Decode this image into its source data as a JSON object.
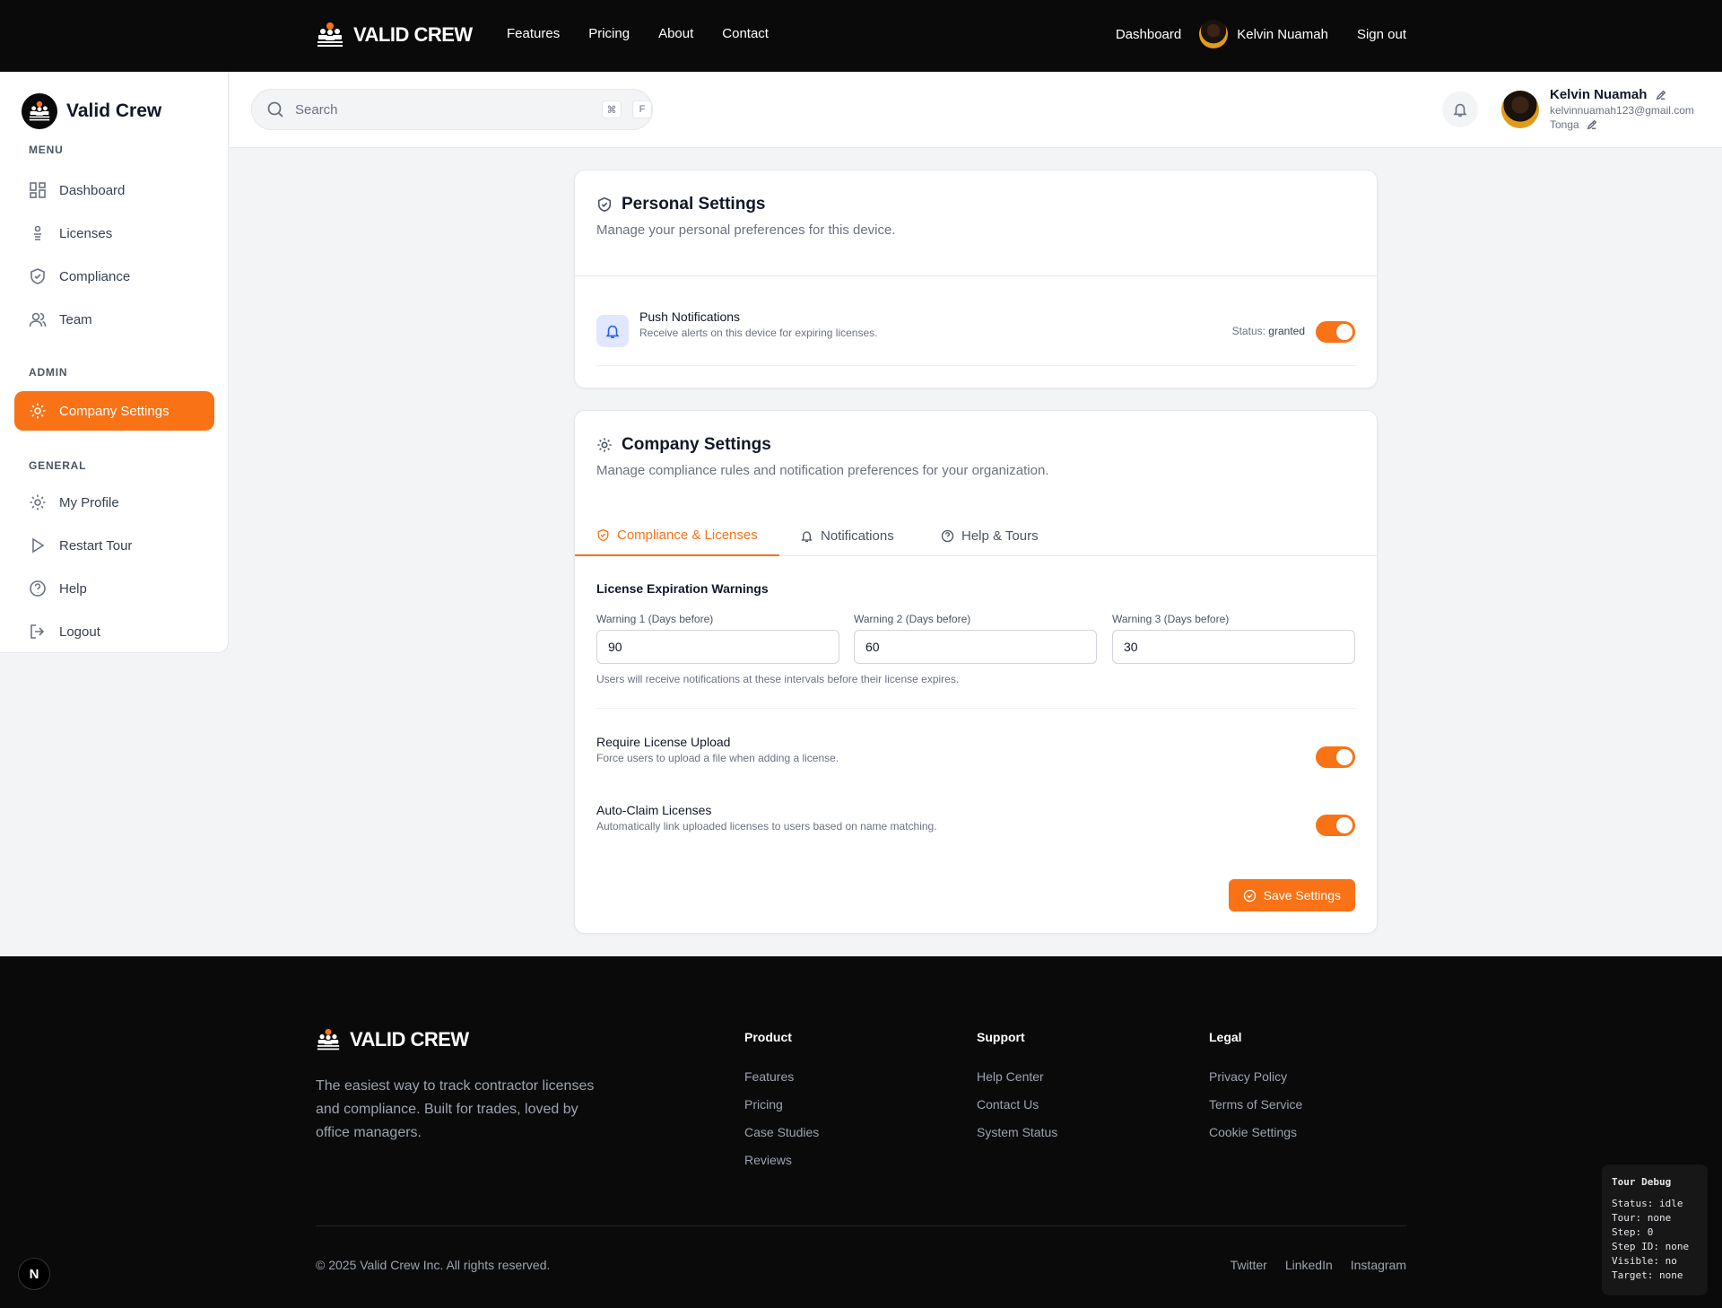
{
  "colors": {
    "accent": "#f97316",
    "nav_bg": "#0a0a0a",
    "page_bg": "#f3f4f6"
  },
  "topnav": {
    "brand": "VALID CREW",
    "links": [
      "Features",
      "Pricing",
      "About",
      "Contact"
    ],
    "dashboard": "Dashboard",
    "user_name": "Kelvin Nuamah",
    "sign_out": "Sign out"
  },
  "sidebar": {
    "brand": "Valid Crew",
    "menu_label": "MENU",
    "menu": [
      {
        "label": "Dashboard",
        "icon": "grid-icon"
      },
      {
        "label": "Licenses",
        "icon": "license-icon"
      },
      {
        "label": "Compliance",
        "icon": "shield-icon"
      },
      {
        "label": "Team",
        "icon": "users-icon"
      }
    ],
    "admin_label": "ADMIN",
    "admin": [
      {
        "label": "Company Settings",
        "icon": "gear-icon",
        "active": true
      }
    ],
    "general_label": "GENERAL",
    "general": [
      {
        "label": "My Profile",
        "icon": "gear-icon"
      },
      {
        "label": "Restart Tour",
        "icon": "play-icon"
      },
      {
        "label": "Help",
        "icon": "help-icon"
      },
      {
        "label": "Logout",
        "icon": "logout-icon"
      }
    ]
  },
  "header": {
    "search_placeholder": "Search",
    "kbd": [
      "⌘",
      "F"
    ],
    "user_name": "Kelvin Nuamah",
    "user_email": "kelvinnuamah123@gmail.com",
    "user_location": "Tonga"
  },
  "personal": {
    "title": "Personal Settings",
    "subtitle": "Manage your personal preferences for this device.",
    "push_title": "Push Notifications",
    "push_sub": "Receive alerts on this device for expiring licenses.",
    "status_label": "Status:",
    "status_value": "granted",
    "push_enabled": true
  },
  "company": {
    "title": "Company Settings",
    "subtitle": "Manage compliance rules and notification preferences for your organization.",
    "tabs": [
      {
        "label": "Compliance & Licenses",
        "icon": "shield-icon",
        "active": true
      },
      {
        "label": "Notifications",
        "icon": "bell-icon"
      },
      {
        "label": "Help & Tours",
        "icon": "help-icon"
      }
    ],
    "warnings_title": "License Expiration Warnings",
    "warnings": [
      {
        "label": "Warning 1 (Days before)",
        "value": "90"
      },
      {
        "label": "Warning 2 (Days before)",
        "value": "60"
      },
      {
        "label": "Warning 3 (Days before)",
        "value": "30"
      }
    ],
    "warnings_help": "Users will receive notifications at these intervals before their license expires.",
    "require_upload_title": "Require License Upload",
    "require_upload_sub": "Force users to upload a file when adding a license.",
    "require_upload_enabled": true,
    "auto_claim_title": "Auto-Claim Licenses",
    "auto_claim_sub": "Automatically link uploaded licenses to users based on name matching.",
    "auto_claim_enabled": true,
    "save_label": "Save Settings"
  },
  "footer": {
    "brand": "VALID CREW",
    "tagline": "The easiest way to track contractor licenses and compliance. Built for trades, loved by office managers.",
    "columns": [
      {
        "title": "Product",
        "links": [
          "Features",
          "Pricing",
          "Case Studies",
          "Reviews"
        ]
      },
      {
        "title": "Support",
        "links": [
          "Help Center",
          "Contact Us",
          "System Status"
        ]
      },
      {
        "title": "Legal",
        "links": [
          "Privacy Policy",
          "Terms of Service",
          "Cookie Settings"
        ]
      }
    ],
    "copyright": "© 2025 Valid Crew Inc. All rights reserved.",
    "social": [
      "Twitter",
      "LinkedIn",
      "Instagram"
    ]
  },
  "next_badge": "N",
  "debug": {
    "title": "Tour Debug",
    "lines": [
      "Status: idle",
      "Tour: none",
      "Step: 0",
      "Step ID: none",
      "Visible: no",
      "Target: none"
    ]
  }
}
